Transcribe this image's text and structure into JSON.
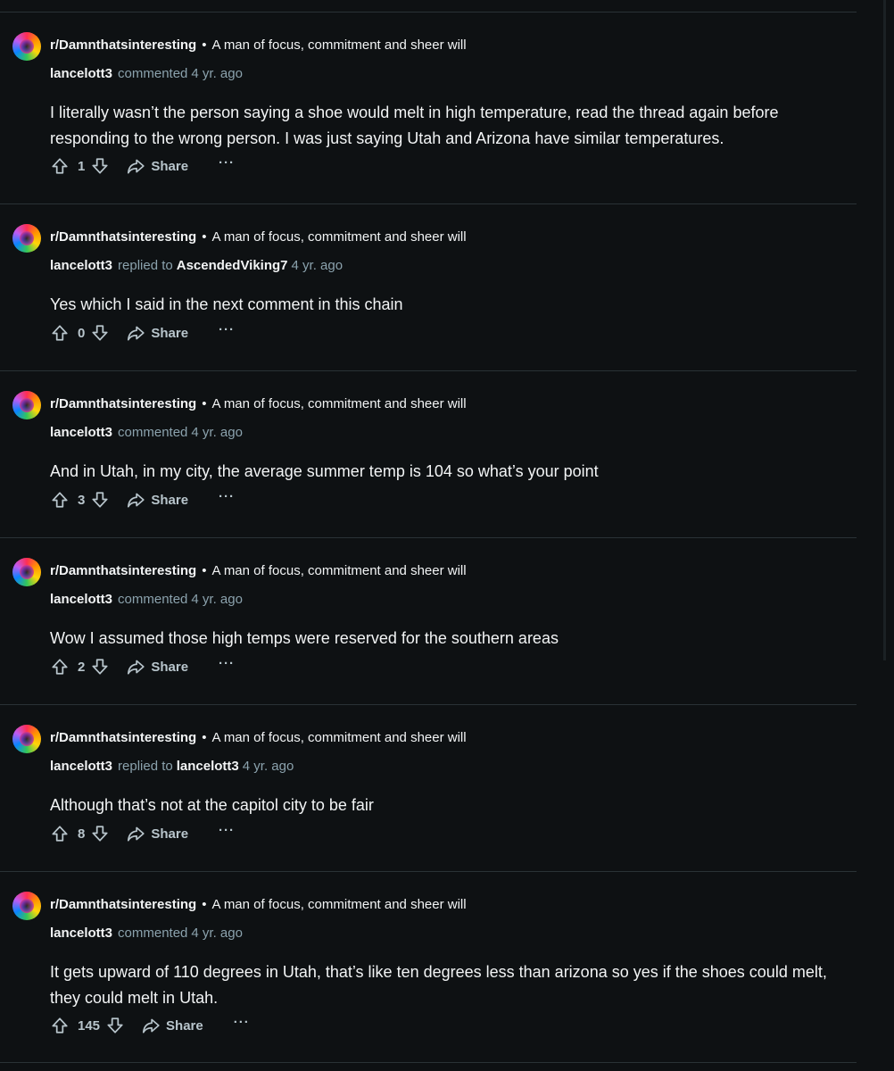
{
  "comments": [
    {
      "subreddit": "r/Damnthatsinteresting",
      "bullet": "•",
      "post_title": "A man of focus, commitment and sheer will",
      "author": "lancelott3",
      "action": "commented",
      "reply_to": "",
      "time": "4 yr. ago",
      "body": "I literally wasn’t the person saying a shoe would melt in high temperature, read the thread again before responding to the wrong person. I was just saying Utah and Arizona have similar temperatures.",
      "score": "1",
      "share_label": "Share",
      "more_label": "···"
    },
    {
      "subreddit": "r/Damnthatsinteresting",
      "bullet": "•",
      "post_title": "A man of focus, commitment and sheer will",
      "author": "lancelott3",
      "action": "replied to",
      "reply_to": "AscendedViking7",
      "time": "4 yr. ago",
      "body": "Yes which I said in the next comment in this chain",
      "score": "0",
      "share_label": "Share",
      "more_label": "···"
    },
    {
      "subreddit": "r/Damnthatsinteresting",
      "bullet": "•",
      "post_title": "A man of focus, commitment and sheer will",
      "author": "lancelott3",
      "action": "commented",
      "reply_to": "",
      "time": "4 yr. ago",
      "body": "And in Utah, in my city, the average summer temp is 104 so what’s your point",
      "score": "3",
      "share_label": "Share",
      "more_label": "···"
    },
    {
      "subreddit": "r/Damnthatsinteresting",
      "bullet": "•",
      "post_title": "A man of focus, commitment and sheer will",
      "author": "lancelott3",
      "action": "commented",
      "reply_to": "",
      "time": "4 yr. ago",
      "body": "Wow I assumed those high temps were reserved for the southern areas",
      "score": "2",
      "share_label": "Share",
      "more_label": "···"
    },
    {
      "subreddit": "r/Damnthatsinteresting",
      "bullet": "•",
      "post_title": "A man of focus, commitment and sheer will",
      "author": "lancelott3",
      "action": "replied to",
      "reply_to": "lancelott3",
      "time": "4 yr. ago",
      "body": "Although that’s not at the capitol city to be fair",
      "score": "8",
      "share_label": "Share",
      "more_label": "···"
    },
    {
      "subreddit": "r/Damnthatsinteresting",
      "bullet": "•",
      "post_title": "A man of focus, commitment and sheer will",
      "author": "lancelott3",
      "action": "commented",
      "reply_to": "",
      "time": "4 yr. ago",
      "body": "It gets upward of 110 degrees in Utah, that’s like ten degrees less than arizona so yes if the shoes could melt, they could melt in Utah.",
      "score": "145",
      "share_label": "Share",
      "more_label": "···"
    }
  ],
  "icons": {
    "avatar": "subreddit-avatar",
    "upvote": "upvote-arrow-icon",
    "downvote": "downvote-arrow-icon",
    "share": "share-arrow-icon",
    "more": "ellipsis-icon"
  },
  "colors": {
    "background": "#0e1113",
    "text": "#f2f4f5",
    "muted": "#8ba2ad",
    "action": "#b8c5cc",
    "divider": "#2a3236"
  }
}
